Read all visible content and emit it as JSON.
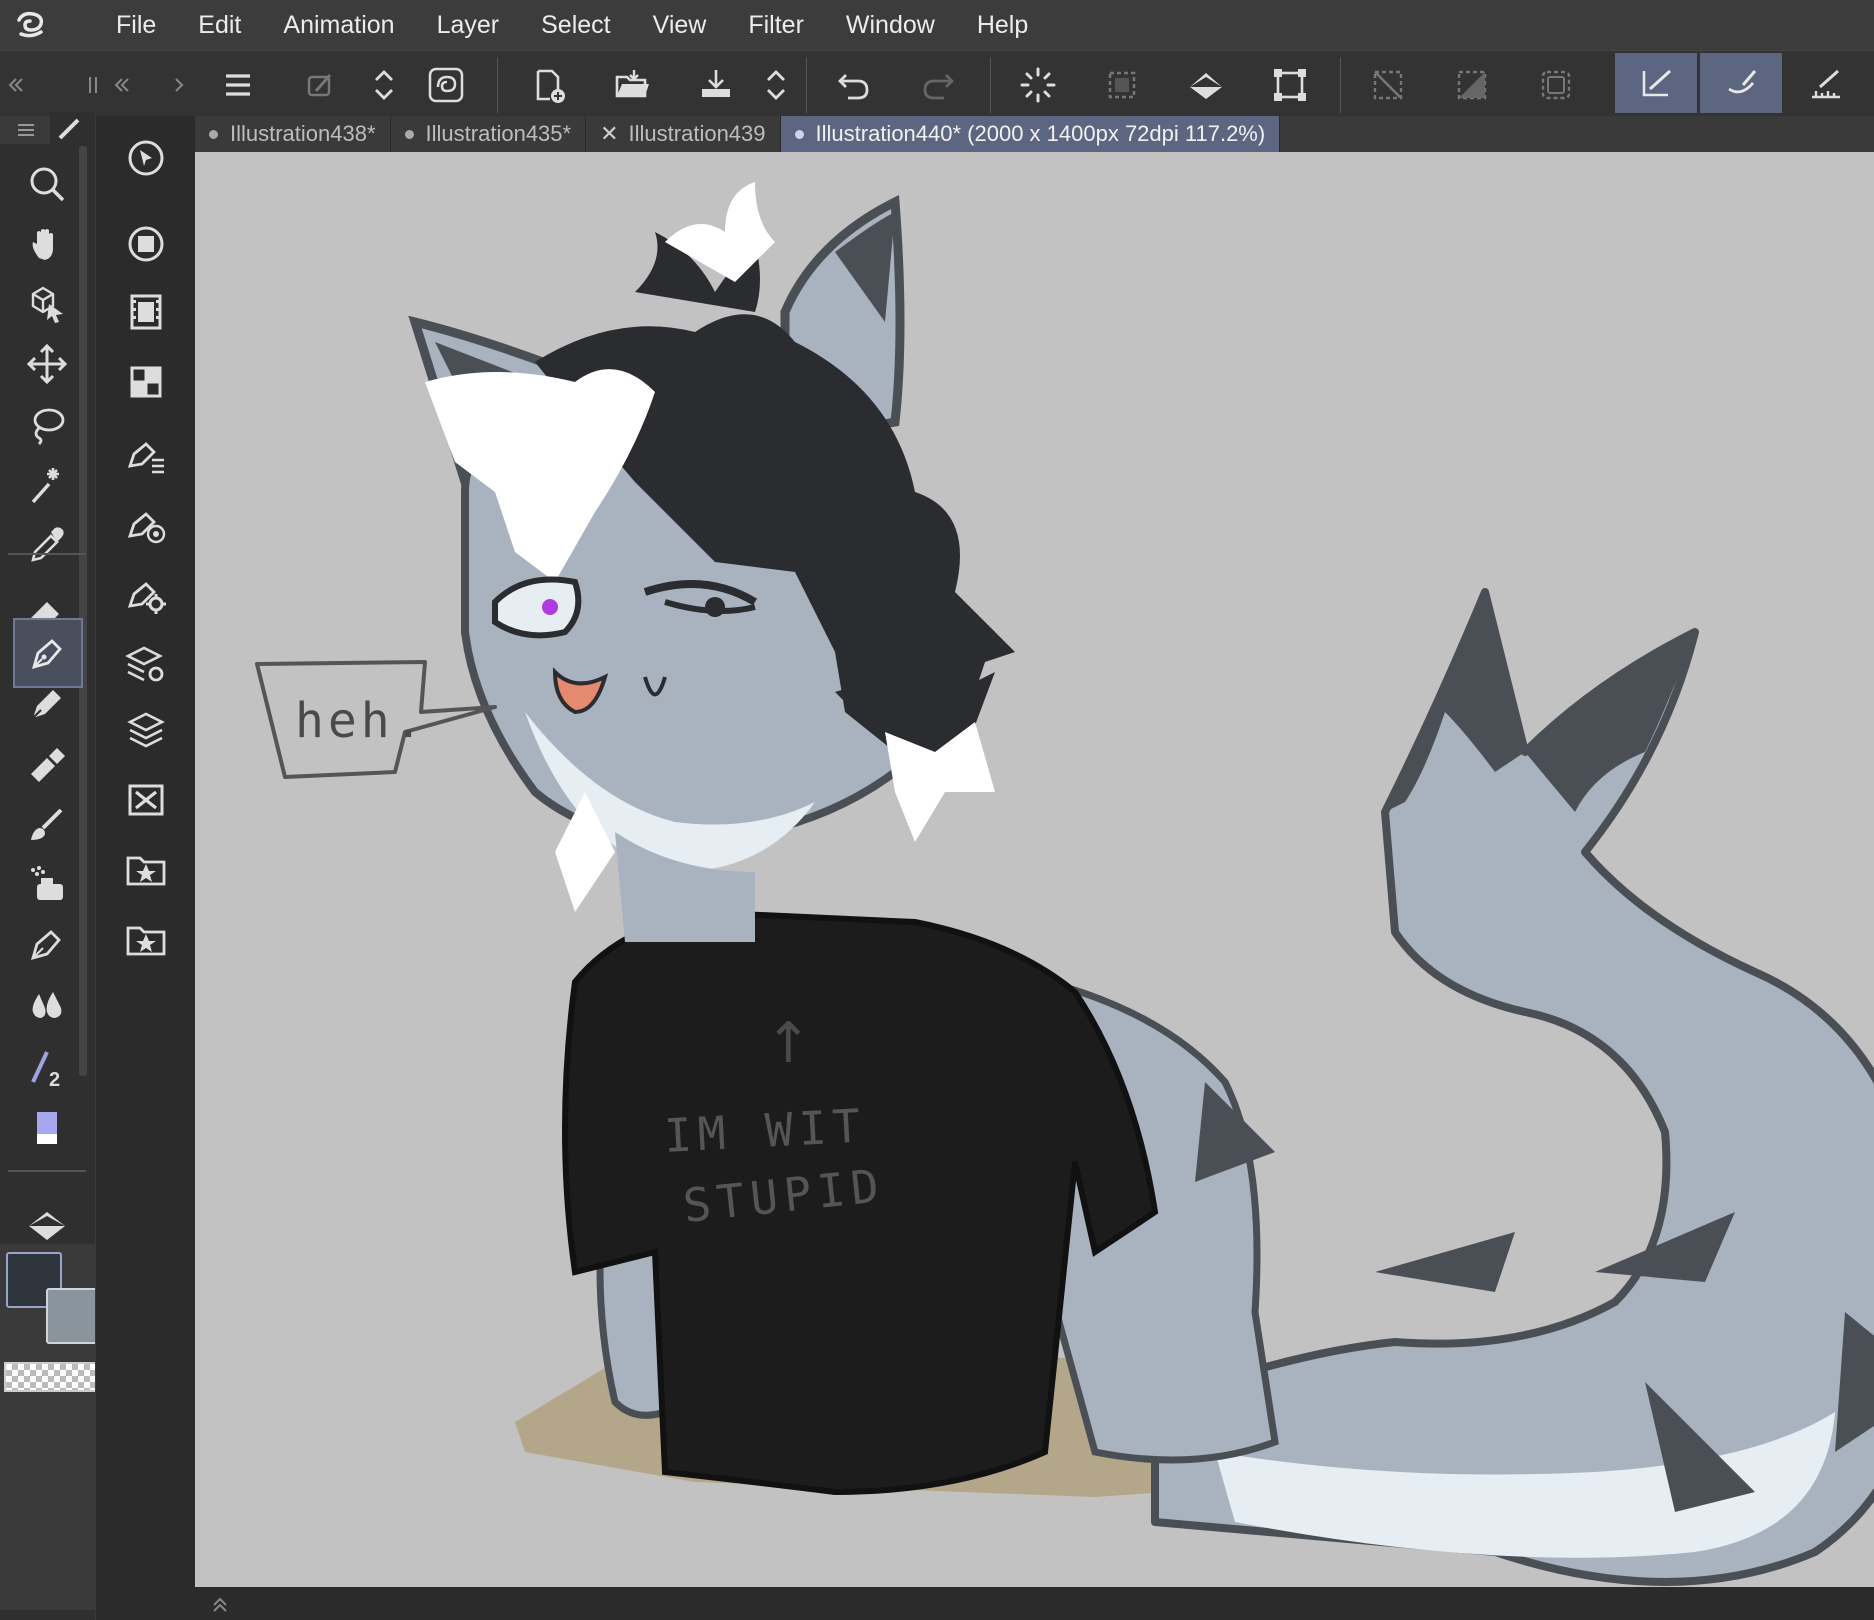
{
  "menu": {
    "items": [
      "File",
      "Edit",
      "Animation",
      "Layer",
      "Select",
      "View",
      "Filter",
      "Window",
      "Help"
    ]
  },
  "tabs": [
    {
      "label": "Illustration438*",
      "marker": "dot"
    },
    {
      "label": "Illustration435*",
      "marker": "dot"
    },
    {
      "label": "Illustration439",
      "marker": "close"
    },
    {
      "label": "Illustration440* (2000 x 1400px 72dpi 117.2%)",
      "marker": "dot",
      "active": true
    }
  ],
  "canvas": {
    "speech_text": "heh.",
    "shirt_text_line1": "IM WIT",
    "shirt_text_line2": "STUPID",
    "shirt_arrow": "↑"
  },
  "colors": {
    "accent": "#5d6681",
    "canvas_bg": "#c2c2c2",
    "main_color": "#2f353c",
    "sub_color": "#8a949c",
    "fur": "#a9b3bf",
    "fur_dark": "#4a4f55",
    "hair": "#2a2c30",
    "shirt": "#1c1c1c",
    "floor": "#b4a789",
    "eye": "#b03be0"
  },
  "icons": {
    "menu_logo": "clip-studio-logo-icon",
    "toolbar": [
      "menu-icon",
      "layer-property-icon",
      "chevron-updown-icon",
      "clip-swirl-icon",
      "new-file-icon",
      "open-folder-icon",
      "save-icon",
      "chevron-updown-icon",
      "undo-icon",
      "redo-icon",
      "loading-spinner-icon",
      "select-dashed-icon",
      "fill-bucket-icon",
      "transform-icon",
      "deselect-icon",
      "invert-selection-icon",
      "select-all-icon",
      "pen-pressure-icon",
      "smoothing-brush-icon",
      "ruler-snap-icon"
    ],
    "lefttools": [
      "zoom-icon",
      "hand-icon",
      "object-select-icon",
      "move-icon",
      "lasso-icon",
      "magic-wand-icon",
      "eyedropper-icon",
      "eraser-icon",
      "pen-icon",
      "pencil-icon",
      "marker-icon",
      "brush-icon",
      "airbrush-icon",
      "decoration-pen-icon",
      "blend-drops-icon",
      "stroke-width-icon",
      "color-swatch-icon",
      "fill-tool-icon"
    ],
    "subtools": [
      "navigator-icon",
      "color-wheel-icon",
      "timeline-icon",
      "layers-grid-icon",
      "vector-tool-icon",
      "vector-target-icon",
      "vector-gear-icon",
      "layer-settings-icon",
      "layers-stack-icon",
      "material-x-icon",
      "material-star-icon",
      "material-star-icon-2"
    ]
  }
}
